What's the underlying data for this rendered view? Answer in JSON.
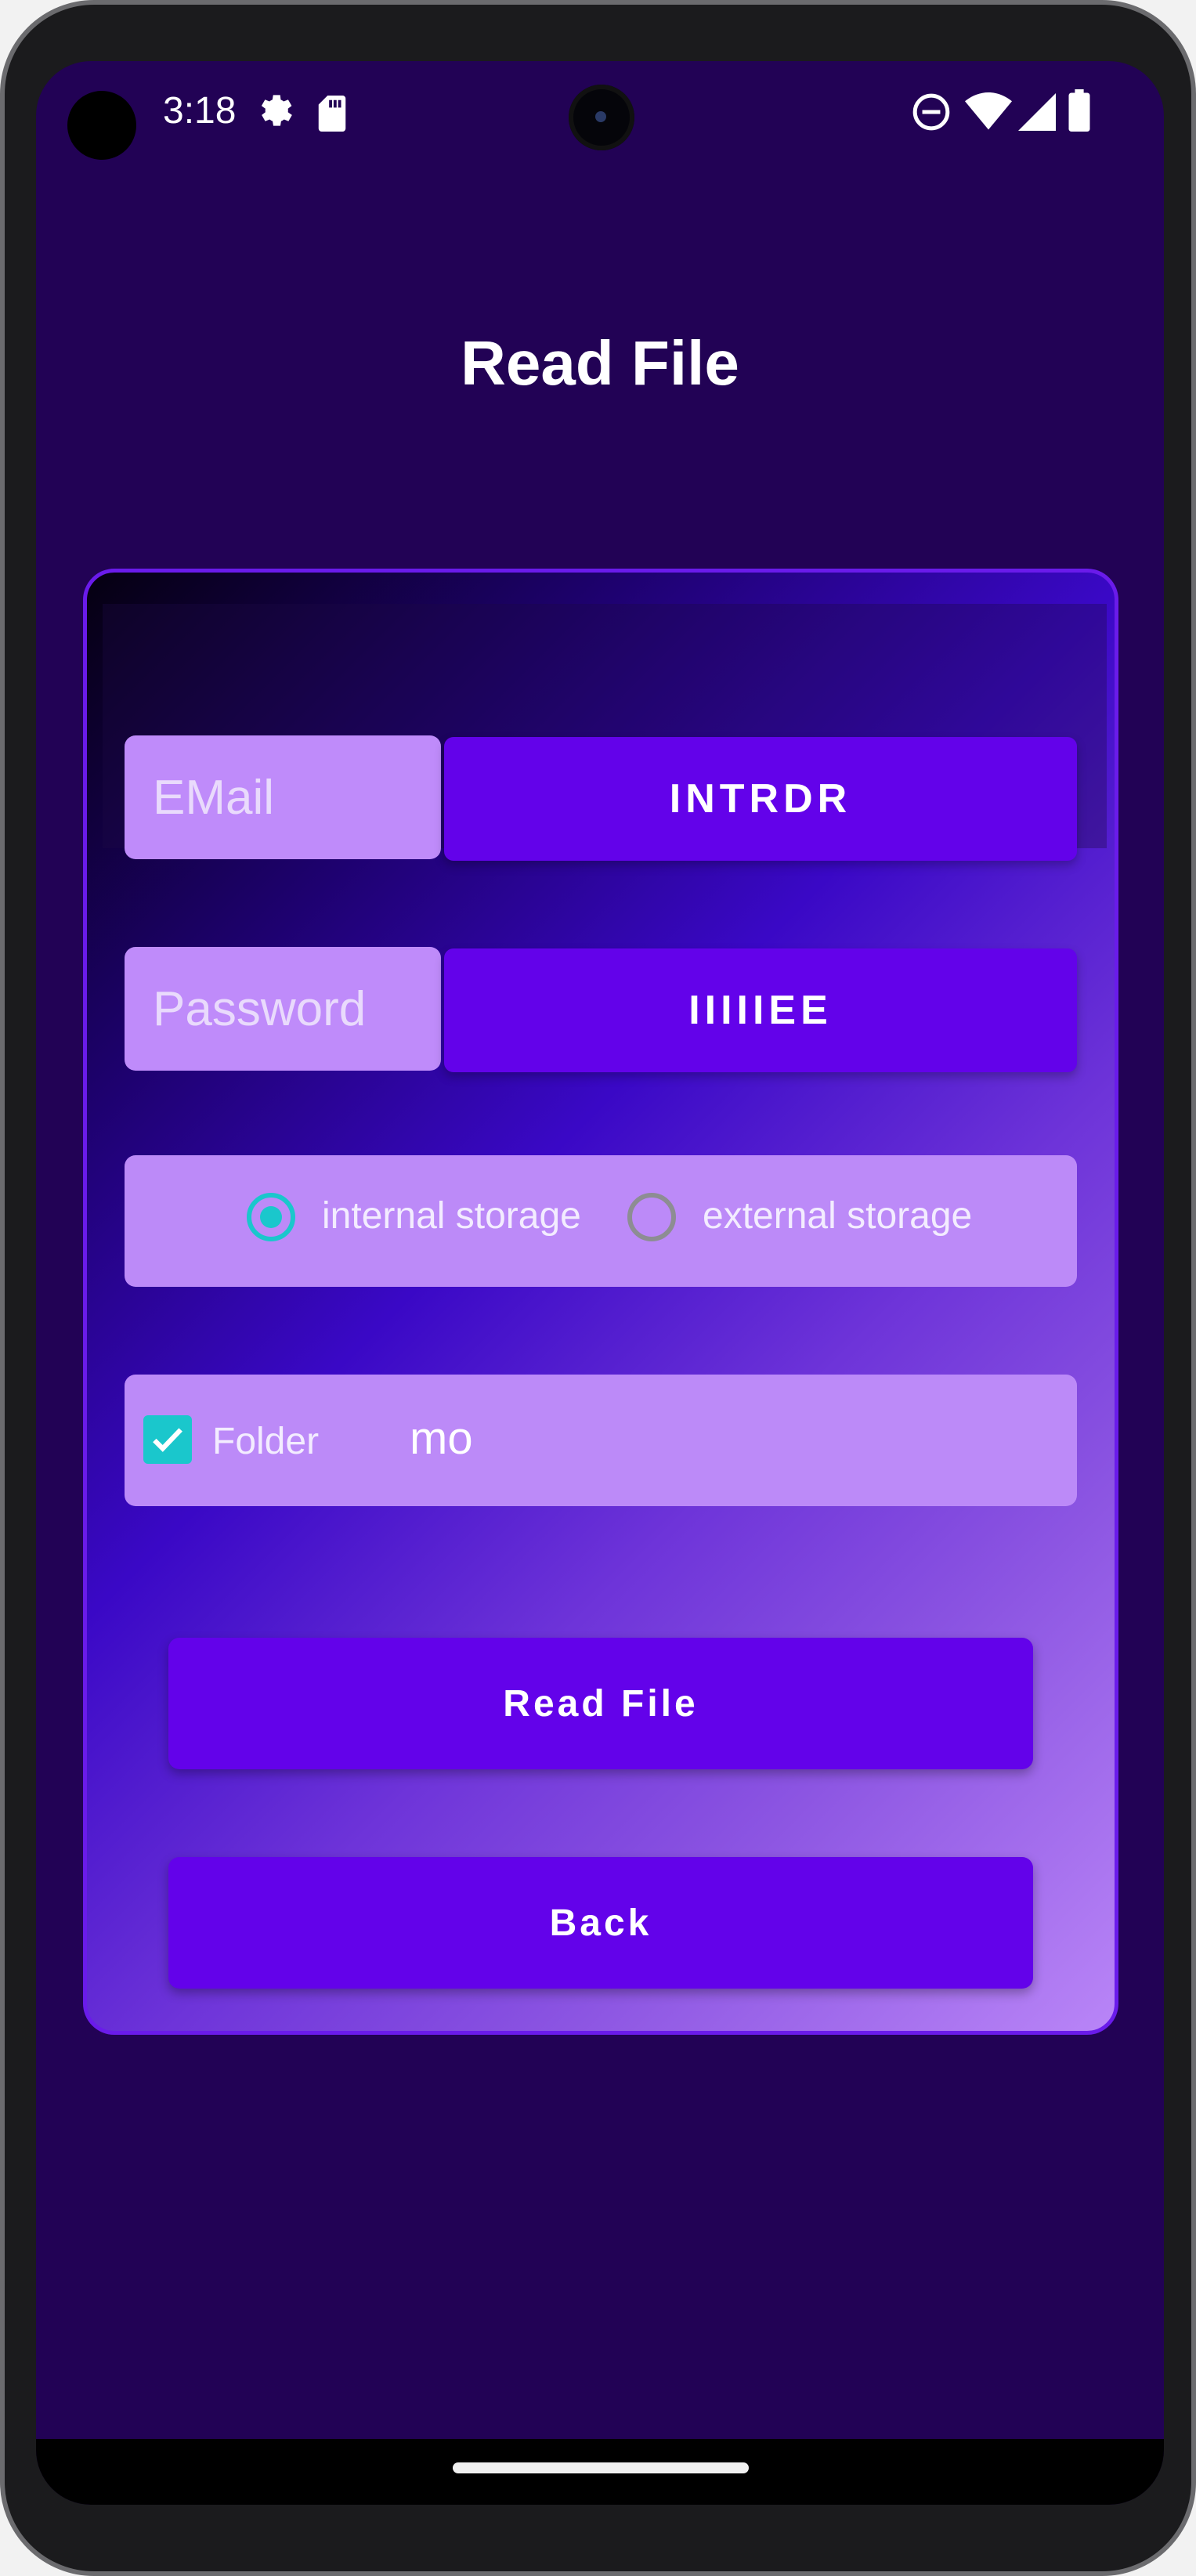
{
  "status_bar": {
    "time": "3:18",
    "icons": [
      "gear-icon",
      "sdcard-icon",
      "dnd-icon",
      "wifi-icon",
      "signal-icon",
      "battery-icon"
    ]
  },
  "page": {
    "title": "Read File"
  },
  "form": {
    "email_label": "EMail",
    "email_value": "INTRDR",
    "password_label": "Password",
    "password_value": "IIIIIEE",
    "storage_options": [
      {
        "label": "internal storage",
        "selected": true
      },
      {
        "label": "external storage",
        "selected": false
      }
    ],
    "folder_checkbox_label": "Folder",
    "folder_checked": true,
    "folder_value": "mo",
    "read_button": "Read File",
    "back_button": "Back"
  },
  "colors": {
    "background": "#220255",
    "accent": "#6302EA",
    "field_light": "#BF8BFA",
    "teal": "#1AC7CC"
  }
}
